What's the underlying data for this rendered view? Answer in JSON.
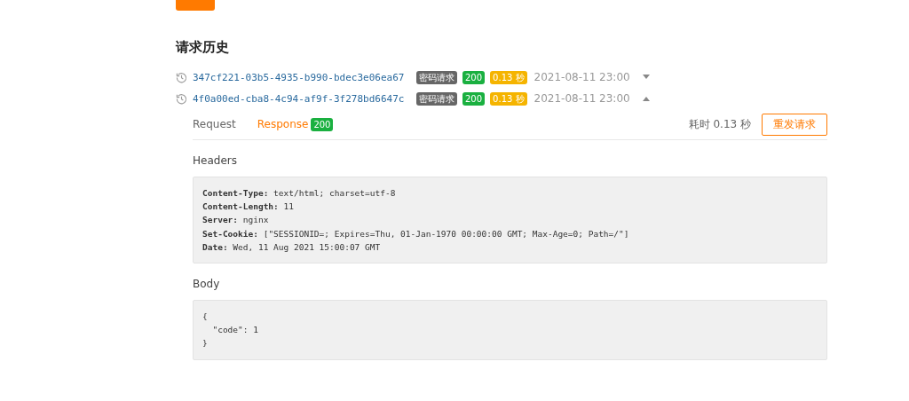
{
  "history": {
    "title": "请求历史",
    "items": [
      {
        "id": "347cf221-03b5-4935-b990-bdec3e06ea67",
        "type_tag": "密码请求",
        "status": "200",
        "duration": "0.13 秒",
        "time": "2021-08-11 23:00",
        "expanded": false
      },
      {
        "id": "4f0a00ed-cba8-4c94-af9f-3f278bd6647c",
        "type_tag": "密码请求",
        "status": "200",
        "duration": "0.13 秒",
        "time": "2021-08-11 23:00",
        "expanded": true
      }
    ]
  },
  "detail": {
    "tabs": [
      {
        "label": "Request",
        "selected": false
      },
      {
        "label": "Response",
        "badge": "200",
        "selected": true
      }
    ],
    "elapsed": "耗时 0.13 秒",
    "resend_button": "重发请求",
    "headers_label": "Headers",
    "headers": [
      {
        "name": "Content-Type:",
        "value": "text/html; charset=utf-8"
      },
      {
        "name": "Content-Length:",
        "value": "11"
      },
      {
        "name": "Server:",
        "value": "nginx"
      },
      {
        "name": "Set-Cookie:",
        "value": "[\"SESSIONID=; Expires=Thu, 01-Jan-1970 00:00:00 GMT; Max-Age=0; Path=/\"]"
      },
      {
        "name": "Date:",
        "value": "Wed, 11 Aug 2021 15:00:07 GMT"
      }
    ],
    "body_label": "Body",
    "body_lines": [
      "{",
      "  \"code\": 1",
      "}"
    ]
  }
}
